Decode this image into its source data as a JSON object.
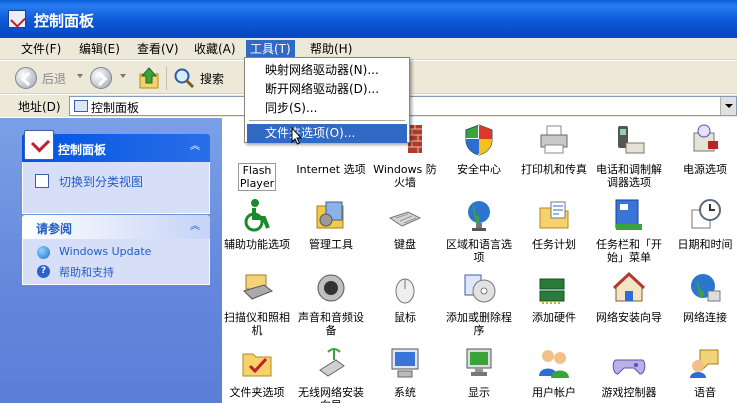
{
  "window": {
    "title": "控制面板"
  },
  "menubar": {
    "items": [
      {
        "label": "文件(F)"
      },
      {
        "label": "编辑(E)"
      },
      {
        "label": "查看(V)"
      },
      {
        "label": "收藏(A)"
      },
      {
        "label": "工具(T)"
      },
      {
        "label": "帮助(H)"
      }
    ]
  },
  "toolbar": {
    "back_label": "后退",
    "search_label": "搜索"
  },
  "address": {
    "label": "地址(D)",
    "value": "控制面板"
  },
  "tools_menu": {
    "items": [
      {
        "label": "映射网络驱动器(N)..."
      },
      {
        "label": "断开网络驱动器(D)..."
      },
      {
        "label": "同步(S)..."
      },
      {
        "label": "文件夹选项(O)..."
      }
    ],
    "highlighted": 3
  },
  "left": {
    "cp_panel": {
      "title": "控制面板",
      "link": "切换到分类视图"
    },
    "see_also": {
      "title": "请参阅",
      "links": [
        {
          "label": "Windows Update"
        },
        {
          "label": "帮助和支持"
        }
      ]
    }
  },
  "items": [
    {
      "label": "Flash Player",
      "icon": "flash-icon"
    },
    {
      "label": "Internet 选项",
      "icon": "internet-options-icon"
    },
    {
      "label": "Windows 防火墙",
      "icon": "firewall-icon"
    },
    {
      "label": "安全中心",
      "icon": "security-center-icon"
    },
    {
      "label": "打印机和传真",
      "icon": "printer-icon"
    },
    {
      "label": "电话和调制解调器选项",
      "icon": "phone-modem-icon"
    },
    {
      "label": "电源选项",
      "icon": "power-icon"
    },
    {
      "label": "辅助功能选项",
      "icon": "accessibility-icon"
    },
    {
      "label": "管理工具",
      "icon": "admin-tools-icon"
    },
    {
      "label": "键盘",
      "icon": "keyboard-icon"
    },
    {
      "label": "区域和语言选项",
      "icon": "globe-icon"
    },
    {
      "label": "任务计划",
      "icon": "scheduled-tasks-icon"
    },
    {
      "label": "任务栏和「开始」菜单",
      "icon": "taskbar-icon"
    },
    {
      "label": "日期和时间",
      "icon": "clock-icon"
    },
    {
      "label": "扫描仪和照相机",
      "icon": "scanner-icon"
    },
    {
      "label": "声音和音频设备",
      "icon": "speaker-icon"
    },
    {
      "label": "鼠标",
      "icon": "mouse-icon"
    },
    {
      "label": "添加或删除程序",
      "icon": "add-remove-icon"
    },
    {
      "label": "添加硬件",
      "icon": "hardware-icon"
    },
    {
      "label": "网络安装向导",
      "icon": "network-wizard-icon"
    },
    {
      "label": "网络连接",
      "icon": "network-connections-icon"
    },
    {
      "label": "文件夹选项",
      "icon": "folder-options-icon"
    },
    {
      "label": "无线网络安装向导",
      "icon": "wireless-icon"
    },
    {
      "label": "系统",
      "icon": "system-icon"
    },
    {
      "label": "显示",
      "icon": "display-icon"
    },
    {
      "label": "用户帐户",
      "icon": "users-icon"
    },
    {
      "label": "游戏控制器",
      "icon": "gamepad-icon"
    },
    {
      "label": "语音",
      "icon": "speech-icon"
    }
  ]
}
